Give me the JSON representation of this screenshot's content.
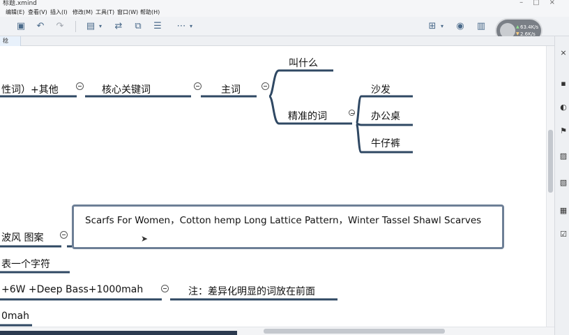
{
  "window": {
    "title": "标题.xmind"
  },
  "menu": [
    "编辑(E)",
    "查看(V)",
    "插入(I)",
    "修改(M)",
    "工具(T)",
    "窗口(W)",
    "帮助(H)"
  ],
  "toolbar": {
    "icons": [
      "save-icon",
      "undo-icon",
      "redo-icon",
      "export-icon",
      "relationship-icon",
      "boundary-icon",
      "summary-icon",
      "more-icon",
      "present-icon",
      "bulb-icon",
      "layout-icon"
    ]
  },
  "speed": {
    "upload": "63.4K/s",
    "download": "2.6K/s"
  },
  "tab": {
    "label": "稔"
  },
  "mindmap": {
    "branch_left_1": "性词）+其他",
    "core_keyword": "核心关键词",
    "main_word": "主词",
    "what_called": "叫什么",
    "precise_words": "精准的词",
    "sofa": "沙发",
    "desk": "办公桌",
    "jeans": "牛仔裤",
    "left_style": "波风  图案",
    "note_text": "Scarfs For Women，Cotton hemp  Long    Lattice Pattern，Winter Tassel Shawl Scarves",
    "one_char": "表一个字符",
    "spec": "+6W +Deep  Bass+1000mah",
    "remark": "注：差异化明显的词放在前面",
    "battery": "0mah"
  },
  "colors": {
    "note_border": "#6d7f96",
    "branch_line": "#2f4863",
    "canvas": "#ffffff"
  }
}
